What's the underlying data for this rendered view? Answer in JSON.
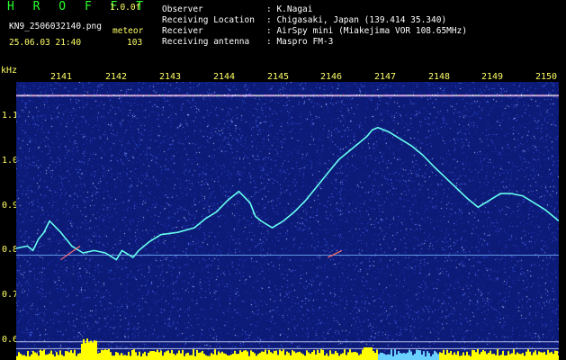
{
  "brand": "H R O F F T",
  "version": "1.0.0f",
  "file_name": "KN9_2506032140.png",
  "timestamp": "25.06.03 21:40",
  "meteor_label": "meteor",
  "meteor_count": "103",
  "observer_fields": [
    {
      "label": "Observer",
      "value": ": K.Nagai"
    },
    {
      "label": "Receiving Location",
      "value": ": Chigasaki, Japan (139.414 35.340)"
    },
    {
      "label": "Receiver",
      "value": ": AirSpy mini (Miakejima VOR 108.65MHz)"
    },
    {
      "label": "Receiving antenna",
      "value": ": Maspro FM-3"
    }
  ],
  "y_axis_unit": "kHz",
  "colors": {
    "background": "#000000",
    "spectrogram_bg": "#0c1a78",
    "text_yellow": "#ffff66",
    "brand_green": "#2bff2b",
    "trace": "#66ffee"
  },
  "chart_data": {
    "type": "heatmap",
    "xlabel": "",
    "ylabel": "kHz",
    "x_ticks": [
      "2141",
      "2142",
      "2143",
      "2144",
      "2145",
      "2146",
      "2147",
      "2148",
      "2149",
      "2150"
    ],
    "y_ticks": [
      "1.1",
      "1.0",
      "0.9",
      "0.8",
      "0.7",
      "0.6"
    ],
    "x_range": [
      2140.7,
      2150.45
    ],
    "y_range": [
      0.58,
      1.19
    ],
    "reference_lines_khz": [
      1.16,
      0.81,
      0.62,
      0.605
    ],
    "trace": {
      "x": [
        2140.7,
        2140.9,
        2141.0,
        2141.1,
        2141.2,
        2141.3,
        2141.5,
        2141.7,
        2141.9,
        2142.1,
        2142.3,
        2142.5,
        2142.6,
        2142.8,
        2142.9,
        2143.1,
        2143.3,
        2143.6,
        2143.9,
        2144.1,
        2144.3,
        2144.5,
        2144.7,
        2144.9,
        2145.0,
        2145.1,
        2145.3,
        2145.5,
        2145.7,
        2145.9,
        2146.1,
        2146.3,
        2146.5,
        2146.7,
        2146.9,
        2147.0,
        2147.1,
        2147.2,
        2147.4,
        2147.6,
        2147.8,
        2148.0,
        2148.2,
        2148.5,
        2148.8,
        2149.0,
        2149.2,
        2149.4,
        2149.6,
        2149.8,
        2150.0,
        2150.2,
        2150.45
      ],
      "y": [
        0.825,
        0.83,
        0.82,
        0.845,
        0.86,
        0.885,
        0.86,
        0.83,
        0.815,
        0.82,
        0.815,
        0.8,
        0.82,
        0.805,
        0.82,
        0.84,
        0.855,
        0.86,
        0.87,
        0.89,
        0.905,
        0.93,
        0.95,
        0.925,
        0.895,
        0.885,
        0.87,
        0.885,
        0.905,
        0.93,
        0.96,
        0.99,
        1.02,
        1.04,
        1.06,
        1.07,
        1.085,
        1.09,
        1.08,
        1.065,
        1.05,
        1.03,
        1.005,
        0.97,
        0.935,
        0.915,
        0.93,
        0.945,
        0.945,
        0.94,
        0.925,
        0.91,
        0.885
      ]
    }
  }
}
